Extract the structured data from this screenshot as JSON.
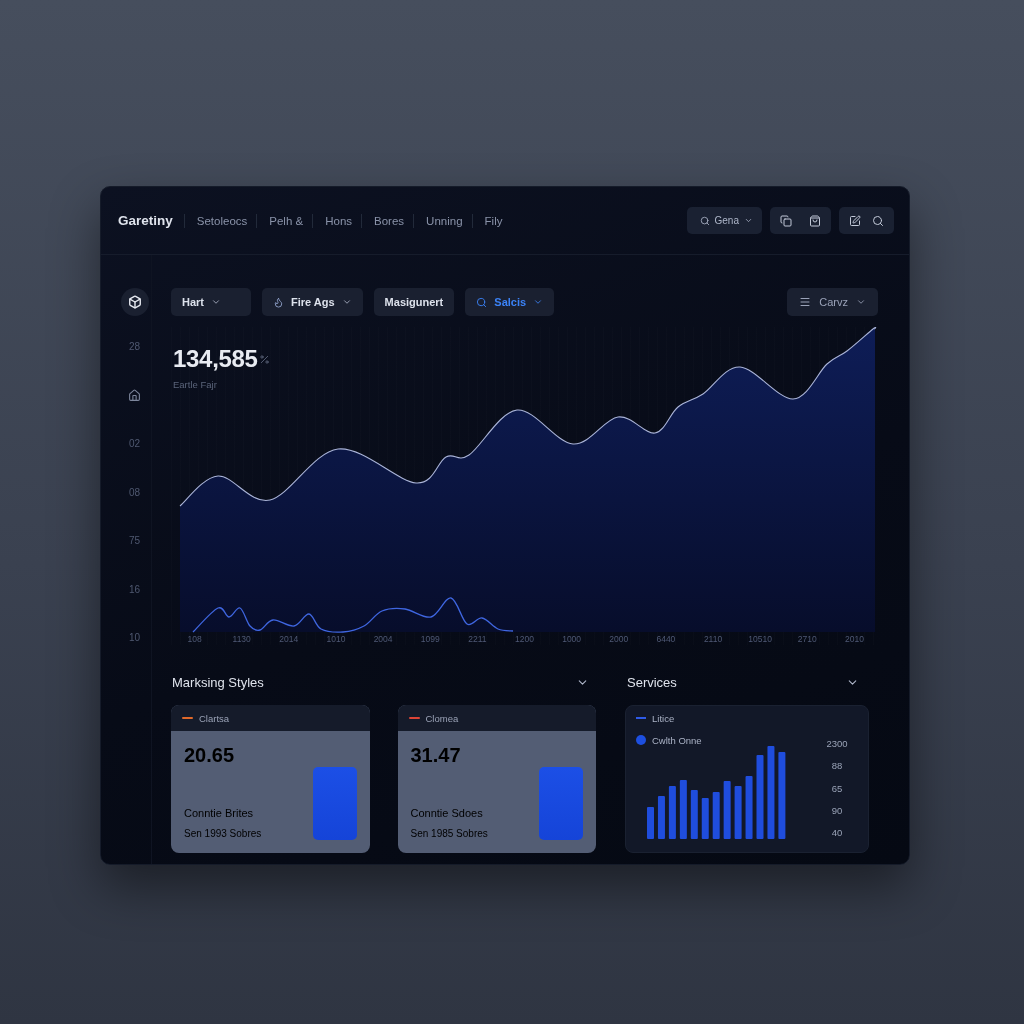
{
  "header": {
    "brand": "Garetiny",
    "nav": [
      "Setoleocs",
      "Pelh &",
      "Hons",
      "Bores",
      "Unning",
      "Fily"
    ],
    "search_button": {
      "label": "Gena"
    }
  },
  "sidebar": {
    "axis_items": [
      {
        "kind": "label",
        "text": "28"
      },
      {
        "kind": "icon"
      },
      {
        "kind": "label",
        "text": "02"
      },
      {
        "kind": "label",
        "text": "08"
      },
      {
        "kind": "label",
        "text": "75"
      },
      {
        "kind": "label",
        "text": "16"
      },
      {
        "kind": "label",
        "text": "10"
      }
    ]
  },
  "filters": [
    {
      "label": "Hart",
      "kind": "menu",
      "selected": false
    },
    {
      "label": "Fire Ags",
      "kind": "flame",
      "selected": false
    },
    {
      "label": "Masigunert",
      "kind": "plain",
      "selected": false
    },
    {
      "label": "Salcis",
      "kind": "search",
      "selected": true
    }
  ],
  "view_menu": {
    "label": "Carvz"
  },
  "headline": {
    "value": "134,585",
    "caption": "Eartle Fajr"
  },
  "chart": {
    "x_labels": [
      "108",
      "1130",
      "2014",
      "1010",
      "2004",
      "1099",
      "2211",
      "1200",
      "1000",
      "2000",
      "6440",
      "2110",
      "10510",
      "2710",
      "2010"
    ]
  },
  "styles_section": {
    "title": "Marksing Styles",
    "cards": [
      {
        "tag": "Clartsa",
        "color": "#e0692a",
        "value": "20.65",
        "label": "Conntie Brites",
        "sublabel": "Sen 1993 Sobres"
      },
      {
        "tag": "Clomea",
        "color": "#dc4436",
        "value": "31.47",
        "label": "Conntie Sdoes",
        "sublabel": "Sen 1985 Sobres"
      }
    ]
  },
  "services_section": {
    "title": "Services",
    "legend": [
      {
        "kind": "dash",
        "label": "Litice"
      },
      {
        "kind": "dot",
        "label": "Cwlth Onne"
      }
    ],
    "y_labels": [
      "2300",
      "88",
      "65",
      "90",
      "40"
    ]
  }
}
